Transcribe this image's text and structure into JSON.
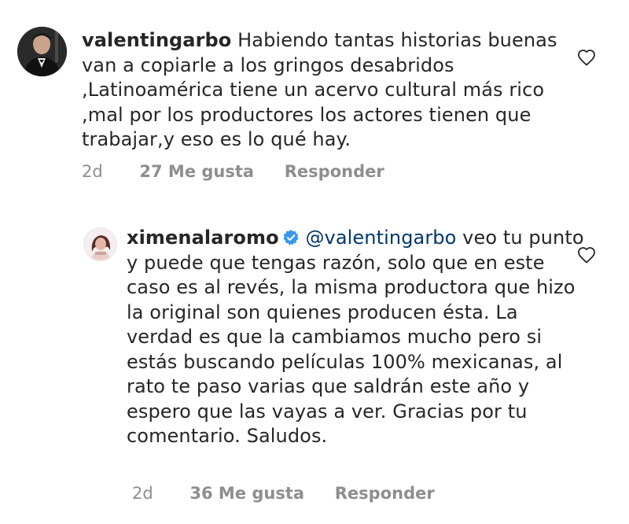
{
  "comments": [
    {
      "username": "valentingarbo",
      "verified": false,
      "mention": "",
      "text": "Habiendo tantas historias buenas van a copiarle a los gringos desabridos ,Latinoamérica tiene un acervo cultural más rico ,mal por los productores los actores tienen que trabajar,y eso es lo qué hay.",
      "time": "2d",
      "likes": "27 Me gusta",
      "reply_label": "Responder",
      "avatar_icon": "user-avatar-photo",
      "like_icon": "heart-outline-icon"
    },
    {
      "username": "ximenalaromo",
      "verified": true,
      "mention": "@valentingarbo",
      "text": "veo tu punto y puede que tengas razón, solo que en este caso es al revés, la misma productora que hizo la original son quienes producen ésta. La verdad es que la cambiamos mucho pero si estás buscando películas 100% mexicanas, al rato te paso varias que saldrán este año y espero que las vayas a ver. Gracias por tu comentario. Saludos.",
      "time": "2d",
      "likes": "36 Me gusta",
      "reply_label": "Responder",
      "avatar_icon": "user-avatar-photo",
      "verified_icon": "verified-badge-icon",
      "like_icon": "heart-outline-icon"
    }
  ],
  "colors": {
    "text": "#262626",
    "meta": "#8e8e8e",
    "mention": "#00376b",
    "verified": "#3897f0"
  }
}
